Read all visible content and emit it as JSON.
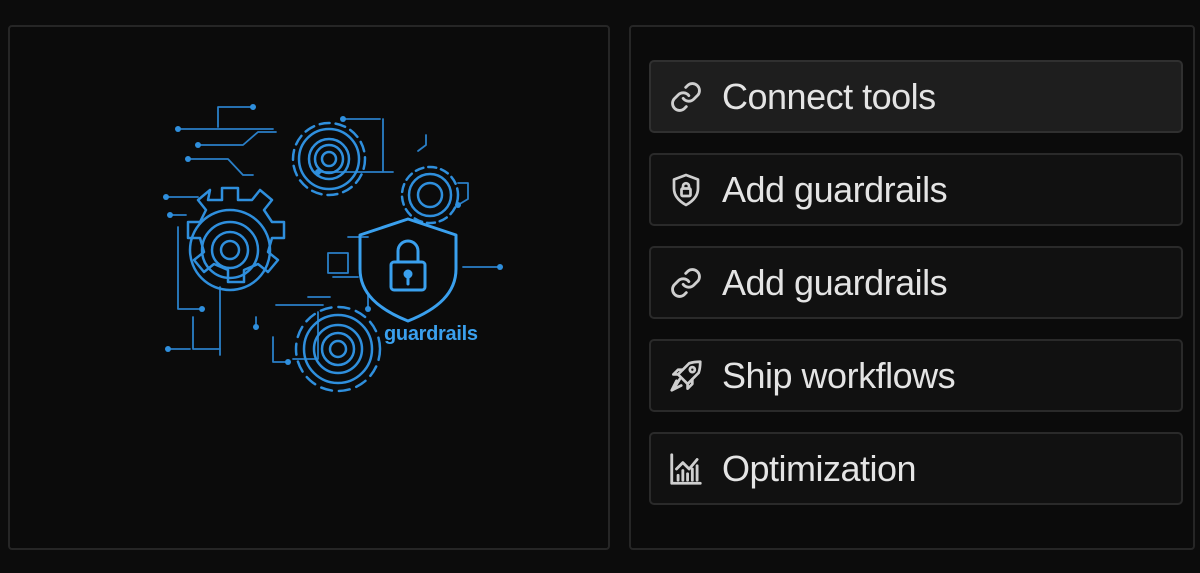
{
  "illustration": {
    "label": "guardrails",
    "icons": [
      "gear-icon",
      "shield-lock-icon",
      "circuit-traces"
    ],
    "accent_color": "#3aa0ee"
  },
  "menu": {
    "items": [
      {
        "label": "Connect tools",
        "icon": "link-icon",
        "active": true
      },
      {
        "label": "Add guardrails",
        "icon": "shield-lock-icon",
        "active": false
      },
      {
        "label": "Add guardrails",
        "icon": "link-icon",
        "active": false
      },
      {
        "label": "Ship workflows",
        "icon": "rocket-icon",
        "active": false
      },
      {
        "label": "Optimization",
        "icon": "chart-icon",
        "active": false
      }
    ]
  },
  "colors": {
    "background": "#0c0c0c",
    "panel_border": "#262626",
    "text": "#e4e4e4",
    "active_item_bg": "#1e1e1e"
  }
}
